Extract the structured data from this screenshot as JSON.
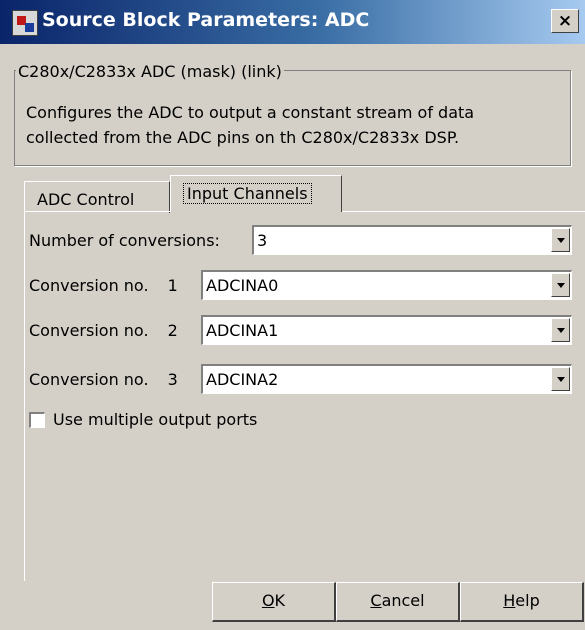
{
  "window": {
    "title": "Source Block Parameters: ADC",
    "close_glyph": "×"
  },
  "mask": {
    "group_title": "C280x/C2833x ADC (mask) (link)",
    "description_line1": "Configures the ADC to output a constant stream of data",
    "description_line2": "collected from the ADC pins on th C280x/C2833x DSP."
  },
  "tabs": [
    {
      "label": "ADC Control",
      "active": false
    },
    {
      "label": "Input Channels",
      "active": true
    }
  ],
  "form": {
    "num_conversions": {
      "label": "Number of conversions:",
      "value": "3"
    },
    "conversions": [
      {
        "prefix": "Conversion no.",
        "index": "1",
        "value": "ADCINA0"
      },
      {
        "prefix": "Conversion no.",
        "index": "2",
        "value": "ADCINA1"
      },
      {
        "prefix": "Conversion no.",
        "index": "3",
        "value": "ADCINA2"
      }
    ],
    "multiple_output": {
      "label": "Use multiple output ports",
      "checked": false
    }
  },
  "buttons": {
    "ok": {
      "mnemonic": "O",
      "rest": "K"
    },
    "cancel": {
      "mnemonic": "C",
      "rest": "ancel"
    },
    "help": {
      "mnemonic": "H",
      "rest": "elp"
    }
  },
  "icons": {
    "app": "simulink-block-icon",
    "dropdown": "chevron-down-icon"
  },
  "colors": {
    "titlebar_start": "#0a246a",
    "titlebar_end": "#a6caf0",
    "face": "#d4d0c8"
  }
}
